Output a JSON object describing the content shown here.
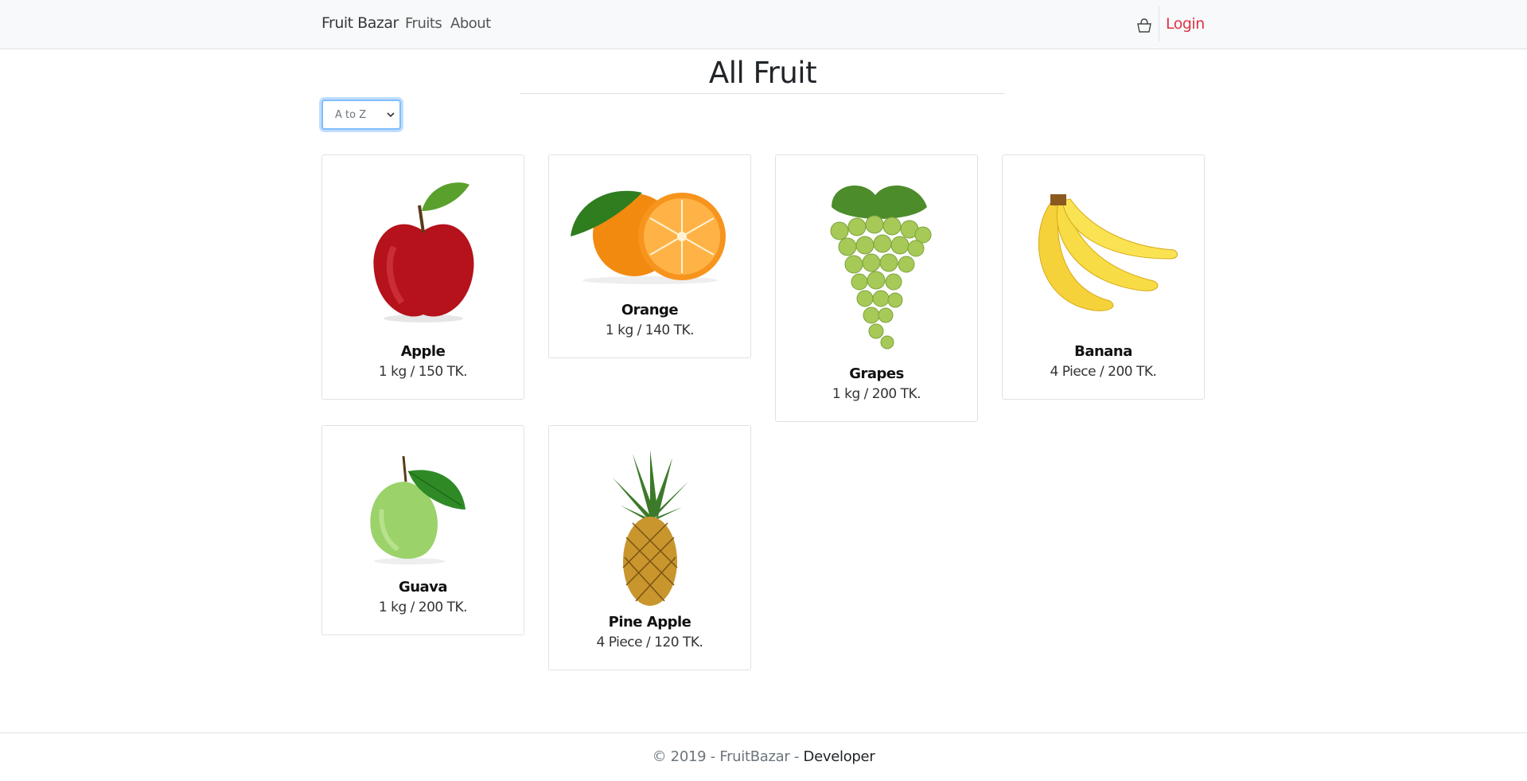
{
  "navbar": {
    "brand": "Fruit Bazar",
    "links": [
      "Fruits",
      "About"
    ],
    "cart_icon": "cart-icon",
    "login": "Login",
    "login_color": "#dc3545"
  },
  "title": "All Fruit",
  "sort": {
    "selected": "A to Z"
  },
  "fruits": [
    {
      "name": "Apple",
      "price": "1 kg / 150 TK.",
      "icon": "apple-image"
    },
    {
      "name": "Orange",
      "price": "1 kg / 140 TK.",
      "icon": "orange-image"
    },
    {
      "name": "Grapes",
      "price": "1 kg / 200 TK.",
      "icon": "grapes-image"
    },
    {
      "name": "Banana",
      "price": "4 Piece / 200 TK.",
      "icon": "banana-image"
    },
    {
      "name": "Guava",
      "price": "1 kg / 200 TK.",
      "icon": "guava-image"
    },
    {
      "name": "Pine Apple",
      "price": "4 Piece / 120 TK.",
      "icon": "pineapple-image"
    }
  ],
  "footer": {
    "prefix": "© 2019 - FruitBazar - ",
    "link": "Developer"
  }
}
